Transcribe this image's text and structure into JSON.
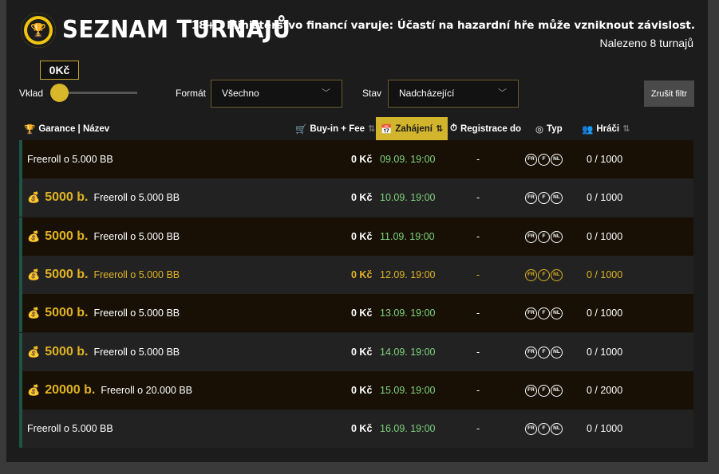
{
  "header": {
    "title": "SEZNAM TURNAJŮ",
    "warning": "18+ | Ministerstvo financí varuje: Účastí na hazardní hře může vzniknout závislost.",
    "found": "Nalezeno 8 turnajů"
  },
  "filters": {
    "vklad_label": "Vklad",
    "vklad_value": "0Kč",
    "format_label": "Formát",
    "format_value": "Všechno",
    "stav_label": "Stav",
    "stav_value": "Nadcházející",
    "reset_label": "Zrušit filtr"
  },
  "columns": {
    "name": "Garance | Název",
    "buyin": "Buy-in + Fee",
    "start": "Zahájení",
    "registration": "Registrace do",
    "type": "Typ",
    "players": "Hráči"
  },
  "rows": [
    {
      "prize": "",
      "name": "Freeroll o 5.000 BB",
      "buyin": "0 Kč",
      "date": "09.09. 19:00",
      "reg": "-",
      "types": [
        "FR",
        "F",
        "NL"
      ],
      "players": "0 / 1000"
    },
    {
      "prize": "5000 b.",
      "name": "Freeroll o 5.000 BB",
      "buyin": "0 Kč",
      "date": "10.09. 19:00",
      "reg": "-",
      "types": [
        "FR",
        "F",
        "NL"
      ],
      "players": "0 / 1000"
    },
    {
      "prize": "5000 b.",
      "name": "Freeroll o 5.000 BB",
      "buyin": "0 Kč",
      "date": "11.09. 19:00",
      "reg": "-",
      "types": [
        "FR",
        "F",
        "NL"
      ],
      "players": "0 / 1000"
    },
    {
      "prize": "5000 b.",
      "name": "Freeroll o 5.000 BB",
      "buyin": "0 Kč",
      "date": "12.09. 19:00",
      "reg": "-",
      "types": [
        "FR",
        "F",
        "NL"
      ],
      "players": "0 / 1000"
    },
    {
      "prize": "5000 b.",
      "name": "Freeroll o 5.000 BB",
      "buyin": "0 Kč",
      "date": "13.09. 19:00",
      "reg": "-",
      "types": [
        "FR",
        "F",
        "NL"
      ],
      "players": "0 / 1000"
    },
    {
      "prize": "5000 b.",
      "name": "Freeroll o 5.000 BB",
      "buyin": "0 Kč",
      "date": "14.09. 19:00",
      "reg": "-",
      "types": [
        "FR",
        "F",
        "NL"
      ],
      "players": "0 / 1000"
    },
    {
      "prize": "20000 b.",
      "name": "Freeroll o 20.000 BB",
      "buyin": "0 Kč",
      "date": "15.09. 19:00",
      "reg": "-",
      "types": [
        "FR",
        "F",
        "NL"
      ],
      "players": "0 / 2000"
    },
    {
      "prize": "",
      "name": "Freeroll o 5.000 BB",
      "buyin": "0 Kč",
      "date": "16.09. 19:00",
      "reg": "-",
      "types": [
        "FR",
        "F",
        "NL"
      ],
      "players": "0 / 1000"
    }
  ],
  "icons": {
    "logo": "trophy-chip-icon",
    "trophy": "trophy-icon",
    "cart": "cart-icon",
    "calendar": "calendar-icon",
    "stopwatch": "stopwatch-icon",
    "chip": "poker-chip-icon",
    "users": "users-icon",
    "moneybag": "money-bag-icon",
    "sort": "sort-icon",
    "chevron": "chevron-down-icon"
  },
  "colors": {
    "accent": "#d2b52c",
    "gold_text": "#e0b322",
    "date_green": "#7fd37f",
    "row_marker": "#1d5448"
  },
  "highlighted_row": 3
}
